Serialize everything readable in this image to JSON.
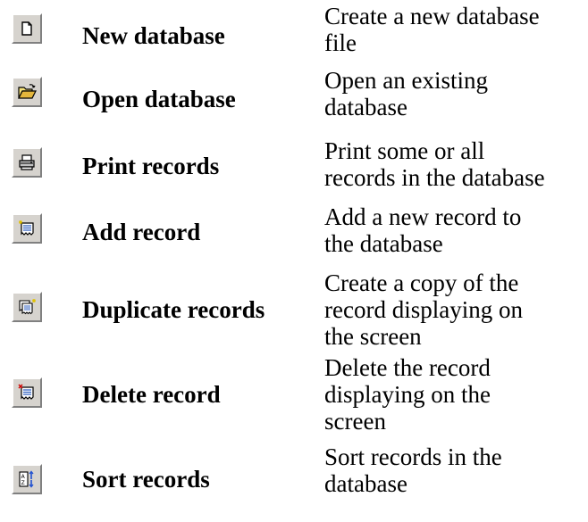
{
  "toolbar_reference": {
    "rows": [
      {
        "icon": "new-document-icon",
        "name": "New database",
        "description_lines": [
          "Create a new database",
          "file"
        ]
      },
      {
        "icon": "open-folder-icon",
        "name": "Open database",
        "description_lines": [
          "Open an existing",
          "database"
        ]
      },
      {
        "icon": "printer-icon",
        "name": "Print records",
        "description_lines": [
          "Print some or all",
          "records in the database"
        ]
      },
      {
        "icon": "add-record-icon",
        "name": "Add record",
        "description_lines": [
          "Add a new record to",
          "the database"
        ]
      },
      {
        "icon": "duplicate-record-icon",
        "name": "Duplicate records",
        "description_lines": [
          "Create a copy of the",
          "record displaying on",
          "the screen"
        ]
      },
      {
        "icon": "delete-record-icon",
        "name": "Delete record",
        "description_lines": [
          "Delete the record",
          "displaying on the",
          "screen"
        ]
      },
      {
        "icon": "sort-records-icon",
        "name": "Sort records",
        "description_lines": [
          "Sort records in the",
          "database"
        ]
      }
    ]
  }
}
